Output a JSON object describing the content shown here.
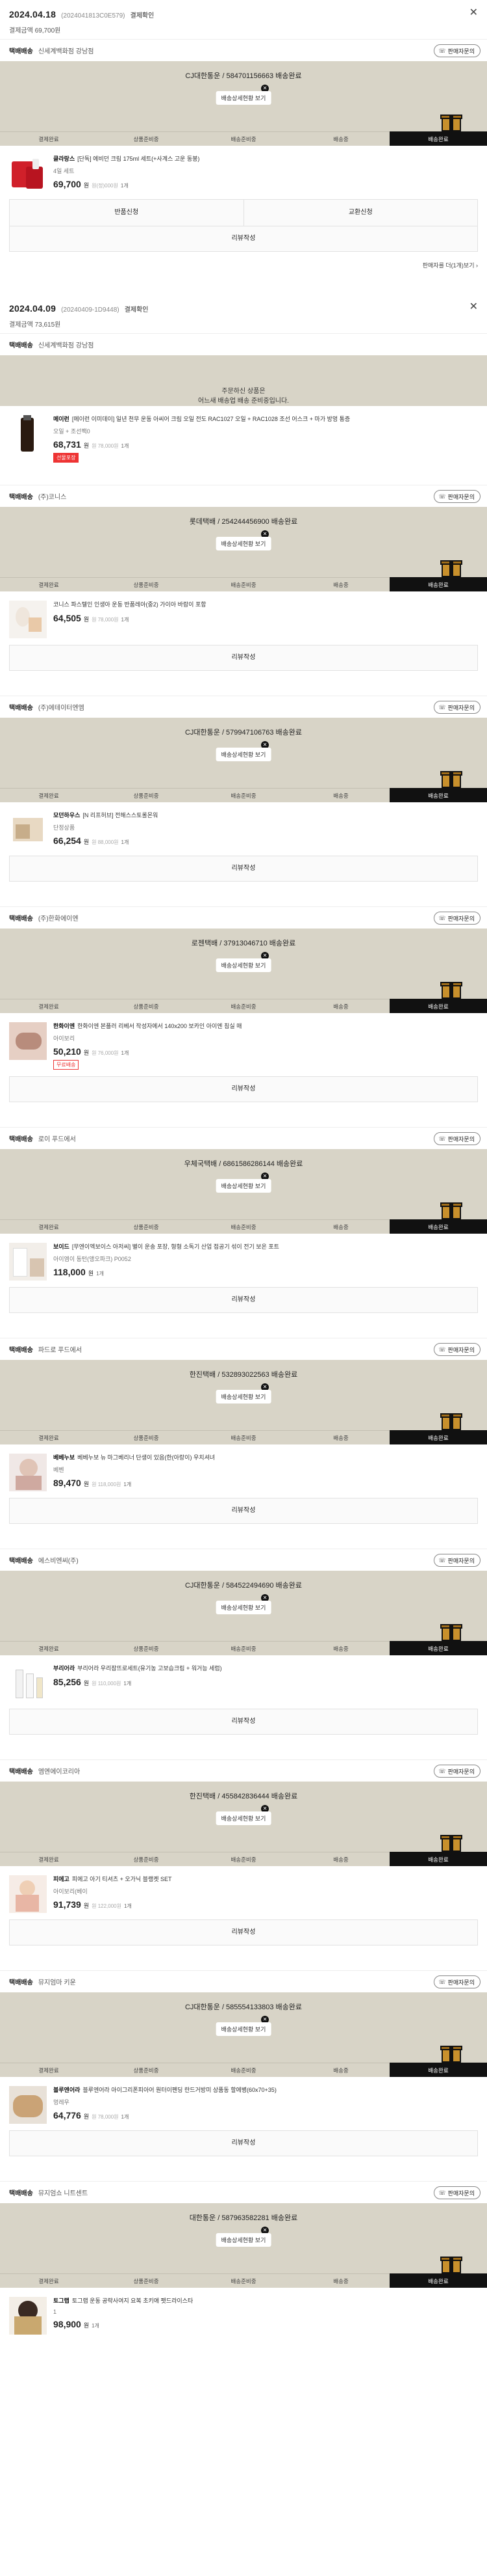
{
  "orders": [
    {
      "date": "2024.04.18",
      "order_no": "(2024041813C0E579)",
      "detail_link": "결제확인",
      "total": "결제금액 69,700원",
      "close_icon": "close-icon",
      "sellers": [
        {
          "label": "택배배송",
          "name": "신세계백화점 강남점",
          "inquiry": "판매자문의",
          "banner": {
            "headline": "CJ대한통운 / 584701156663 배송완료",
            "button": "배송상세현황 보기",
            "steps": [
              "결제완료",
              "상품준비중",
              "배송준비중",
              "배송중",
              "배송완료"
            ],
            "active_step": 4
          },
          "products": [
            {
              "brand": "클라랑스",
              "name": "[단독] 에비던 크림 175ml 세트(+사계스 고운 동봉)",
              "option": "4일 세트",
              "price": "69,700",
              "orig": "원(정)000원",
              "qty": "1개",
              "art": "red"
            }
          ],
          "actions": [
            "반품신청",
            "교환신청",
            "리뷰작성"
          ],
          "review_link": "판매자를 더(1개)보기 ›"
        }
      ]
    },
    {
      "date": "2024.04.09",
      "order_no": "(20240409-1D9448)",
      "detail_link": "결제확인",
      "total": "결제금액 73,615원",
      "close_icon": "close-icon",
      "sellers": [
        {
          "label": "택배배송",
          "name": "신세계백화점 강남점",
          "inquiry": "",
          "banner": {
            "pending": true,
            "headline": "주문하신 상품은\n어느새 배송업 배송 준비중입니다."
          },
          "products": [
            {
              "brand": "메이런",
              "name": "[메이런 이미데이] 일년 천무 운동 아씨어 크림 오일 전도 RAC1027 오일 + RAC1028 조선 어스크 + 마가 방멍 통증",
              "option": "오일 + 조선팩0",
              "price": "68,731",
              "orig": "원 78,000원",
              "qty": "1개",
              "tag": "선물포장",
              "art": "bottle"
            }
          ]
        },
        {
          "label": "택배배송",
          "name": "(주)코니스",
          "inquiry": "판매자문의",
          "banner": {
            "headline": "롯데택배 / 254244456900 배송완료",
            "button": "배송상세현황 보기",
            "steps": [
              "결제완료",
              "상품준비중",
              "배송준비중",
              "배송중",
              "배송완료"
            ],
            "active_step": 4
          },
          "products": [
            {
              "brand": "",
              "name": "코니스 파스텔인 인생아 운동 반품레아(중2) 가이아 바람이 포함",
              "option": "",
              "price": "64,505",
              "orig": "원 78,000원",
              "qty": "1개",
              "art": "kid"
            }
          ],
          "actions": [
            "리뷰작성"
          ]
        },
        {
          "label": "택배배송",
          "name": "(주)에테이터엔엠",
          "inquiry": "판매자문의",
          "banner": {
            "headline": "CJ대한통운 / 579947106763 배송완료",
            "button": "배송상세현황 보기",
            "steps": [
              "결제완료",
              "상품준비중",
              "배송준비중",
              "배송중",
              "배송완료"
            ],
            "active_step": 4
          },
          "products": [
            {
              "brand": "모던하우스",
              "name": "[N 리프허브] 전해스스토롤몬워",
              "option": "단정상품",
              "price": "66,254",
              "orig": "원 88,000원",
              "qty": "1개",
              "art": "box"
            }
          ],
          "actions": [
            "리뷰작성"
          ]
        },
        {
          "label": "택배배송",
          "name": "(주)한화에이엔",
          "inquiry": "판매자문의",
          "banner": {
            "headline": "로젠택배 / 37913046710 배송완료",
            "button": "배송상세현황 보기",
            "steps": [
              "결제완료",
              "상품준비중",
              "배송준비중",
              "배송중",
              "배송완료"
            ],
            "active_step": 4
          },
          "products": [
            {
              "brand": "한화이엔",
              "name": "한화이엔 본플러 리베서 작성자에서 140x200 보카인 아이엔 침실 매",
              "option": "아이보리",
              "price": "50,210",
              "orig": "원 76,000원",
              "qty": "1개",
              "tag": "무료배송",
              "art": "hand"
            }
          ],
          "actions": [
            "리뷰작성"
          ]
        },
        {
          "label": "택배배송",
          "name": "로이 푸드에서",
          "inquiry": "판매자문의",
          "banner": {
            "headline": "우체국택배 / 6861586286144 배송완료",
            "button": "배송상세현황 보기",
            "steps": [
              "결제완료",
              "상품준비중",
              "배송준비중",
              "배송중",
              "배송완료"
            ],
            "active_step": 4
          },
          "products": [
            {
              "brand": "보이드",
              "name": "[무엔이엑보이스 아저씨] 별이 운송 포장, 형형 소독기 산업 접공기 섞이 전기 보온 포트",
              "option": "아이엠이 동턴(앵오파크) P0052",
              "price": "118,000",
              "orig": "",
              "qty": "1개",
              "art": "desk"
            }
          ],
          "actions": [
            "리뷰작성"
          ]
        },
        {
          "label": "택배배송",
          "name": "파드로 푸드에서",
          "inquiry": "판매자문의",
          "banner": {
            "headline": "한진택배 / 532893022563 배송완료",
            "button": "배송상세현황 보기",
            "steps": [
              "결제완료",
              "상품준비중",
              "배송준비중",
              "배송중",
              "배송완료"
            ],
            "active_step": 4
          },
          "products": [
            {
              "brand": "베베누보",
              "name": "베베누보 뉴 마그베리너 단생이 있음(한(아랑이) 우치셔녀",
              "option": "베벤",
              "price": "89,470",
              "orig": "원 118,000원",
              "qty": "1개",
              "art": "face"
            }
          ],
          "actions": [
            "리뷰작성"
          ]
        },
        {
          "label": "택배배송",
          "name": "에스비엔씨(주)",
          "inquiry": "판매자문의",
          "banner": {
            "headline": "CJ대한통운 / 584522494690 배송완료",
            "button": "배송상세현황 보기",
            "steps": [
              "결제완료",
              "상품준비중",
              "배송준비중",
              "배송중",
              "배송완료"
            ],
            "active_step": 4
          },
          "products": [
            {
              "brand": "부리어라",
              "name": "부리어라 우리잠뜨로세트(유기농 고보습크림 + 워거능 세럼)",
              "option": "",
              "price": "85,256",
              "orig": "원 110,000원",
              "qty": "1개",
              "art": "tubes"
            }
          ],
          "actions": [
            "리뷰작성"
          ]
        },
        {
          "label": "택배배송",
          "name": "엠엔에이코리아",
          "inquiry": "판매자문의",
          "banner": {
            "headline": "한진택배 / 455842836444 배송완료",
            "button": "배송상세현황 보기",
            "steps": [
              "결제완료",
              "상품준비중",
              "배송준비중",
              "배송중",
              "배송완료"
            ],
            "active_step": 4
          },
          "products": [
            {
              "brand": "피에고",
              "name": "피에고 아기 티셔츠 + 오가닉 블랭켓 SET",
              "option": "아이보리(베이",
              "price": "91,739",
              "orig": "원 122,000원",
              "qty": "1개",
              "art": "baby"
            }
          ],
          "actions": [
            "리뷰작성"
          ]
        },
        {
          "label": "택배배송",
          "name": "뮤지엄마 키운",
          "inquiry": "판매자문의",
          "banner": {
            "headline": "CJ대한통운 / 585554133803 배송완료",
            "button": "배송상세현황 보기",
            "steps": [
              "결제완료",
              "상품준비중",
              "배송준비중",
              "배송중",
              "배송완료"
            ],
            "active_step": 4
          },
          "products": [
            {
              "brand": "블루엔어라",
              "name": "블루엔어라 아이그리폰피아어 원터이펜딩 란드거방미 상품동 할에병(60x70+35)",
              "option": "멍레우",
              "price": "64,776",
              "orig": "원 78,000원",
              "qty": "1개",
              "art": "dog"
            }
          ],
          "actions": [
            "리뷰작성"
          ]
        },
        {
          "label": "택배배송",
          "name": "뮤지엄쇼 니트센트",
          "inquiry": "판매자문의",
          "banner": {
            "headline": "대한통운 / 587963582281 배송완료",
            "button": "배송상세현황 보기",
            "steps": [
              "결제완료",
              "상품준비중",
              "배송준비중",
              "배송중",
              "배송완료"
            ],
            "active_step": 4
          },
          "products": [
            {
              "brand": "토그랩",
              "name": "토그랩 운동 공략사여지 요복 초키애 펫드라이스타",
              "option": "1",
              "price": "98,900",
              "orig": "",
              "qty": "1개",
              "art": "dark"
            }
          ]
        }
      ]
    }
  ]
}
